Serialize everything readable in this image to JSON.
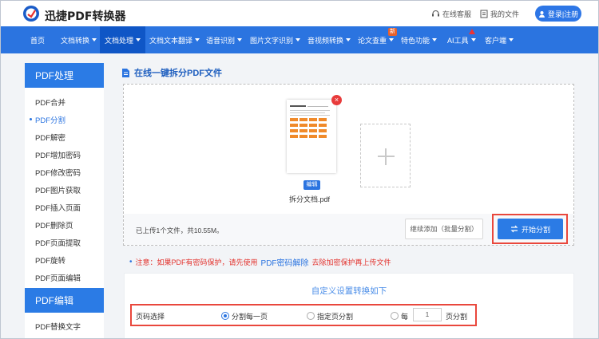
{
  "header": {
    "brand": "迅捷PDF转换器",
    "online_service": "在线客服",
    "my_files": "我的文件",
    "login": "登录|注册",
    "accent": "#2b74e0"
  },
  "nav": {
    "items": [
      {
        "label": "首页",
        "dropdown": false
      },
      {
        "label": "文档转换",
        "dropdown": true
      },
      {
        "label": "文档处理",
        "dropdown": true,
        "active": true
      },
      {
        "label": "文档文本翻译",
        "dropdown": true
      },
      {
        "label": "语音识别",
        "dropdown": true
      },
      {
        "label": "图片文字识别",
        "dropdown": true
      },
      {
        "label": "音视频转换",
        "dropdown": true
      },
      {
        "label": "论文查重",
        "dropdown": true
      },
      {
        "label": "特色功能",
        "dropdown": true
      },
      {
        "label": "AI工具",
        "dropdown": true
      },
      {
        "label": "客户端",
        "dropdown": true
      }
    ],
    "new_badge": "新"
  },
  "sidebar": {
    "section1": "PDF处理",
    "items1": [
      "PDF合并",
      "PDF分割",
      "PDF解密",
      "PDF增加密码",
      "PDF修改密码",
      "PDF图片获取",
      "PDF插入页面",
      "PDF删除页",
      "PDF页面提取",
      "PDF旋转",
      "PDF页面编辑"
    ],
    "active_index": 1,
    "section2": "PDF编辑",
    "items2": [
      "PDF替换文字"
    ]
  },
  "main": {
    "title": "在线一键拆分PDF文件",
    "file_name": "拆分文档.pdf",
    "edit_tag": "编辑",
    "upload_status": "已上传1个文件，共10.55M。",
    "continue_button": "继续添加（批量分割）",
    "start_button": "开始分割",
    "note_prefix": "注意：如果PDF有密码保护，请先使用",
    "note_link": "PDF密码解除",
    "note_suffix": "去除加密保护再上传文件"
  },
  "settings": {
    "title": "自定义设置转换如下",
    "label": "页码选择",
    "options": [
      "分割每一页",
      "指定页分割",
      "每",
      "页分割"
    ],
    "selected": "分割每一页",
    "pages_value": "1"
  }
}
